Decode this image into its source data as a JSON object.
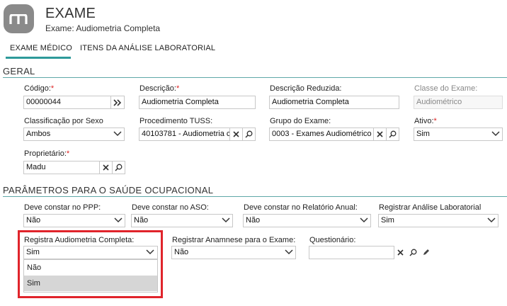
{
  "header": {
    "title": "EXAME",
    "subtitle": "Exame: Audiometria Completa"
  },
  "tabs": [
    {
      "label": "EXAME MÉDICO",
      "active": true
    },
    {
      "label": "ITENS DA ANÁLISE LABORATORIAL",
      "active": false
    }
  ],
  "geral": {
    "section_title": "GERAL",
    "codigo": {
      "label": "Código:",
      "required": "*",
      "value": "00000044"
    },
    "descricao": {
      "label": "Descrição:",
      "required": "*",
      "value": "Audiometria Completa"
    },
    "descricao_reduzida": {
      "label": "Descrição Reduzida:",
      "value": "Audiometria Completa"
    },
    "classe": {
      "label": "Classe do Exame:",
      "value": "Audiométrico"
    },
    "classificacao_sexo": {
      "label": "Classificação por Sexo",
      "value": "Ambos"
    },
    "procedimento_tuss": {
      "label": "Procedimento TUSS:",
      "value": "40103781 - Audiometria c"
    },
    "grupo_exame": {
      "label": "Grupo do Exame:",
      "value": "0003 - Exames Audiométrico"
    },
    "ativo": {
      "label": "Ativo:",
      "required": "*",
      "value": "Sim"
    },
    "proprietario": {
      "label": "Proprietário:",
      "required": "*",
      "value": "Madu"
    }
  },
  "parametros": {
    "section_title": "PARÂMETROS PARA O SAÚDE OCUPACIONAL",
    "ppp": {
      "label": "Deve constar no PPP:",
      "value": "Não"
    },
    "aso": {
      "label": "Deve constar no ASO:",
      "value": "Não"
    },
    "relatorio_anual": {
      "label": "Deve constar no Relatório Anual:",
      "value": "Não"
    },
    "analise_lab": {
      "label": "Registrar Análise Laboratorial",
      "value": "Sim"
    },
    "audiometria": {
      "label": "Registra Audiometria Completa:",
      "value": "Sim",
      "options": [
        "Não",
        "Sim"
      ]
    },
    "anamnese": {
      "label": "Registrar Anamnese para o Exame:",
      "value": "Não"
    },
    "questionario": {
      "label": "Questionário:",
      "value": ""
    }
  },
  "colors": {
    "accent": "#2e9a9a",
    "highlight": "#e0242b",
    "required": "#d22"
  }
}
